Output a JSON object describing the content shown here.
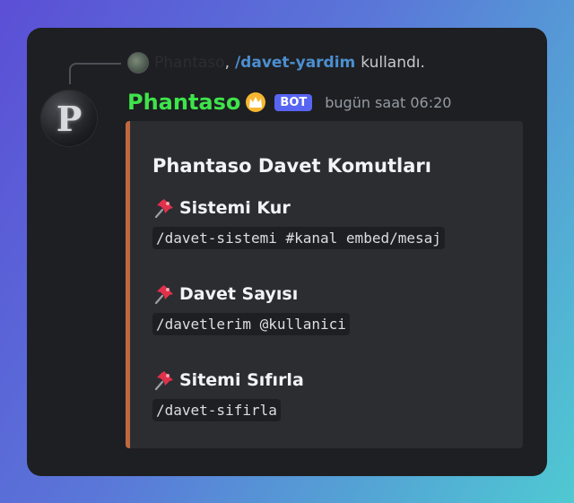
{
  "reply": {
    "username": "Phantaso",
    "separator": ",",
    "command": "/davet-yardim",
    "action": "kullandı."
  },
  "message": {
    "avatar_letter": "P",
    "username": "Phantaso",
    "badge": "BOT",
    "timestamp": "bugün saat 06:20",
    "icons": {
      "badge_icon": "crown-icon",
      "field_icon": "pushpin-icon"
    }
  },
  "embed": {
    "accent_color": "#c1693e",
    "title": "Phantaso Davet Komutları",
    "fields": [
      {
        "name": "Sistemi Kur",
        "value": "/davet-sistemi #kanal embed/mesaj"
      },
      {
        "name": "Davet Sayısı",
        "value": "/davetlerim @kullanici"
      },
      {
        "name": "Sitemi Sıfırla",
        "value": "/davet-sifirla"
      }
    ]
  },
  "colors": {
    "username": "#3ee44b",
    "command_link": "#4b8fd0",
    "bot_badge": "#5865f2",
    "background": "#1e1f22",
    "embed_bg": "#2b2d31"
  }
}
